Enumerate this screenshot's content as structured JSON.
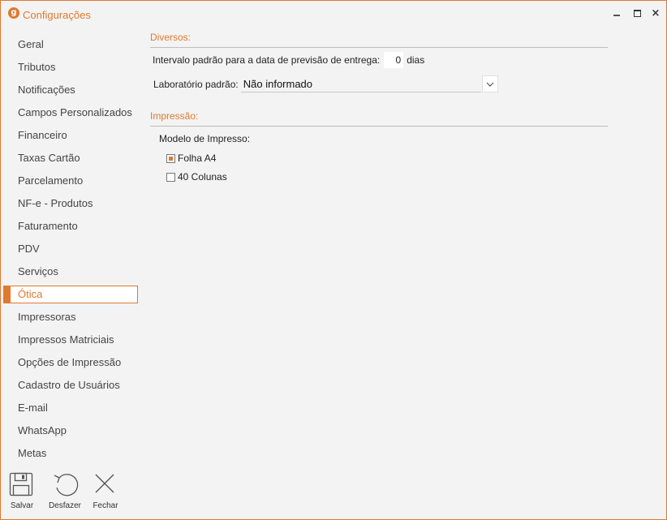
{
  "window": {
    "title": "Configurações",
    "logo_letter": "g",
    "accent_color": "#e07a2e",
    "controls": {
      "minimize": "minimize-icon",
      "maximize": "maximize-icon",
      "close": "×"
    }
  },
  "sidebar": {
    "items": [
      {
        "label": "Geral"
      },
      {
        "label": "Tributos"
      },
      {
        "label": "Notificações"
      },
      {
        "label": "Campos Personalizados"
      },
      {
        "label": "Financeiro"
      },
      {
        "label": "Taxas Cartão"
      },
      {
        "label": "Parcelamento"
      },
      {
        "label": "NF-e - Produtos"
      },
      {
        "label": "Faturamento"
      },
      {
        "label": "PDV"
      },
      {
        "label": "Serviços"
      },
      {
        "label": "Ótica",
        "active": true
      },
      {
        "label": "Impressoras"
      },
      {
        "label": "Impressos Matriciais"
      },
      {
        "label": "Opções de Impressão"
      },
      {
        "label": "Cadastro de Usuários"
      },
      {
        "label": "E-mail"
      },
      {
        "label": "WhatsApp"
      },
      {
        "label": "Metas"
      }
    ]
  },
  "diversos": {
    "title": "Diversos:",
    "interval_label": "Intervalo padrão para a data de previsão de entrega:",
    "interval_value": "0",
    "interval_unit": "dias",
    "lab_label": "Laboratório padrão:",
    "lab_value": "Não informado"
  },
  "impressao": {
    "title": "Impressão:",
    "model_label": "Modelo de Impresso:",
    "options": [
      {
        "label": "Folha A4",
        "checked": true
      },
      {
        "label": "40 Colunas",
        "checked": false
      }
    ]
  },
  "toolbar": {
    "save_label": "Salvar",
    "undo_label": "Desfazer",
    "close_label": "Fechar"
  }
}
